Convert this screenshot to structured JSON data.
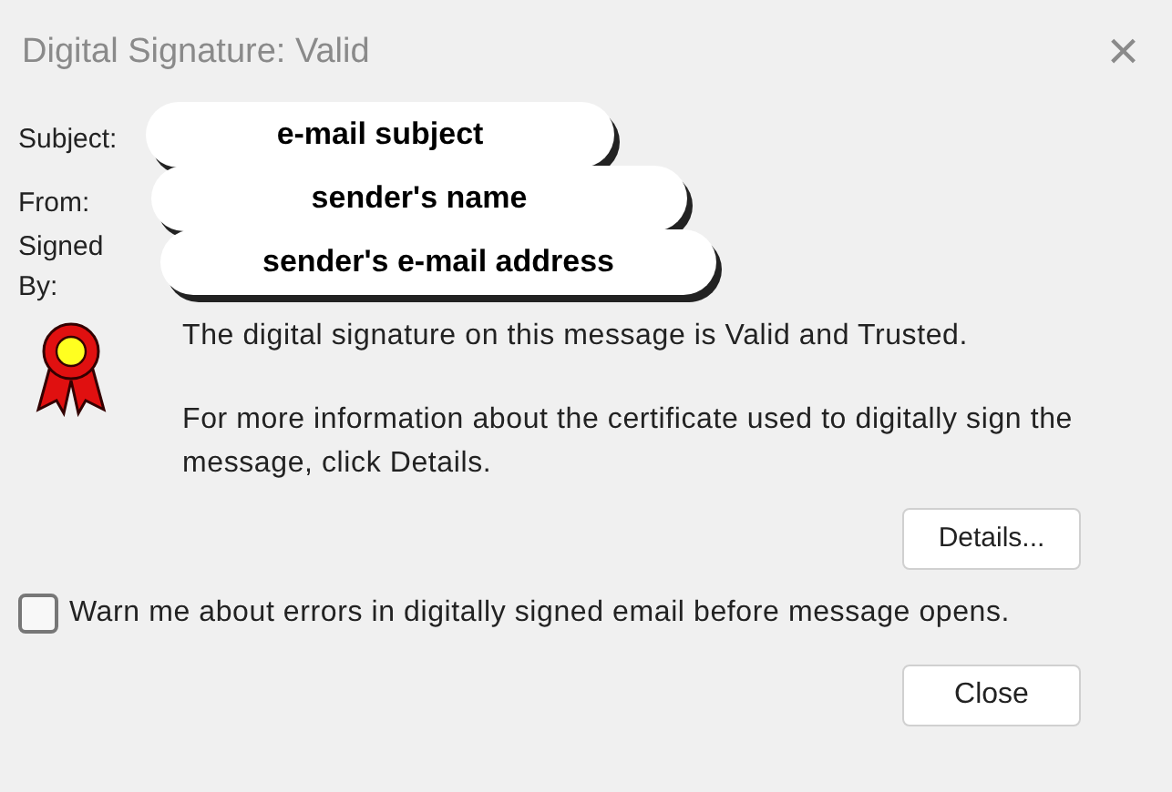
{
  "window": {
    "title": "Digital Signature: Valid",
    "close": "×"
  },
  "fields": [
    {
      "label": "Subject:",
      "value": "e-mail subject"
    },
    {
      "label": "From:",
      "value": "sender's name"
    },
    {
      "label": "Signed By:",
      "value": "sender's e-mail address"
    }
  ],
  "message": [
    "The digital signature on this message is Valid and Trusted.",
    "For more information about the certificate used to digitally sign the message, click Details."
  ],
  "details_button": "Details...",
  "warn_checkbox": {
    "label": "Warn me about errors in digitally signed email before message opens.",
    "checked": false
  },
  "close_button": "Close"
}
